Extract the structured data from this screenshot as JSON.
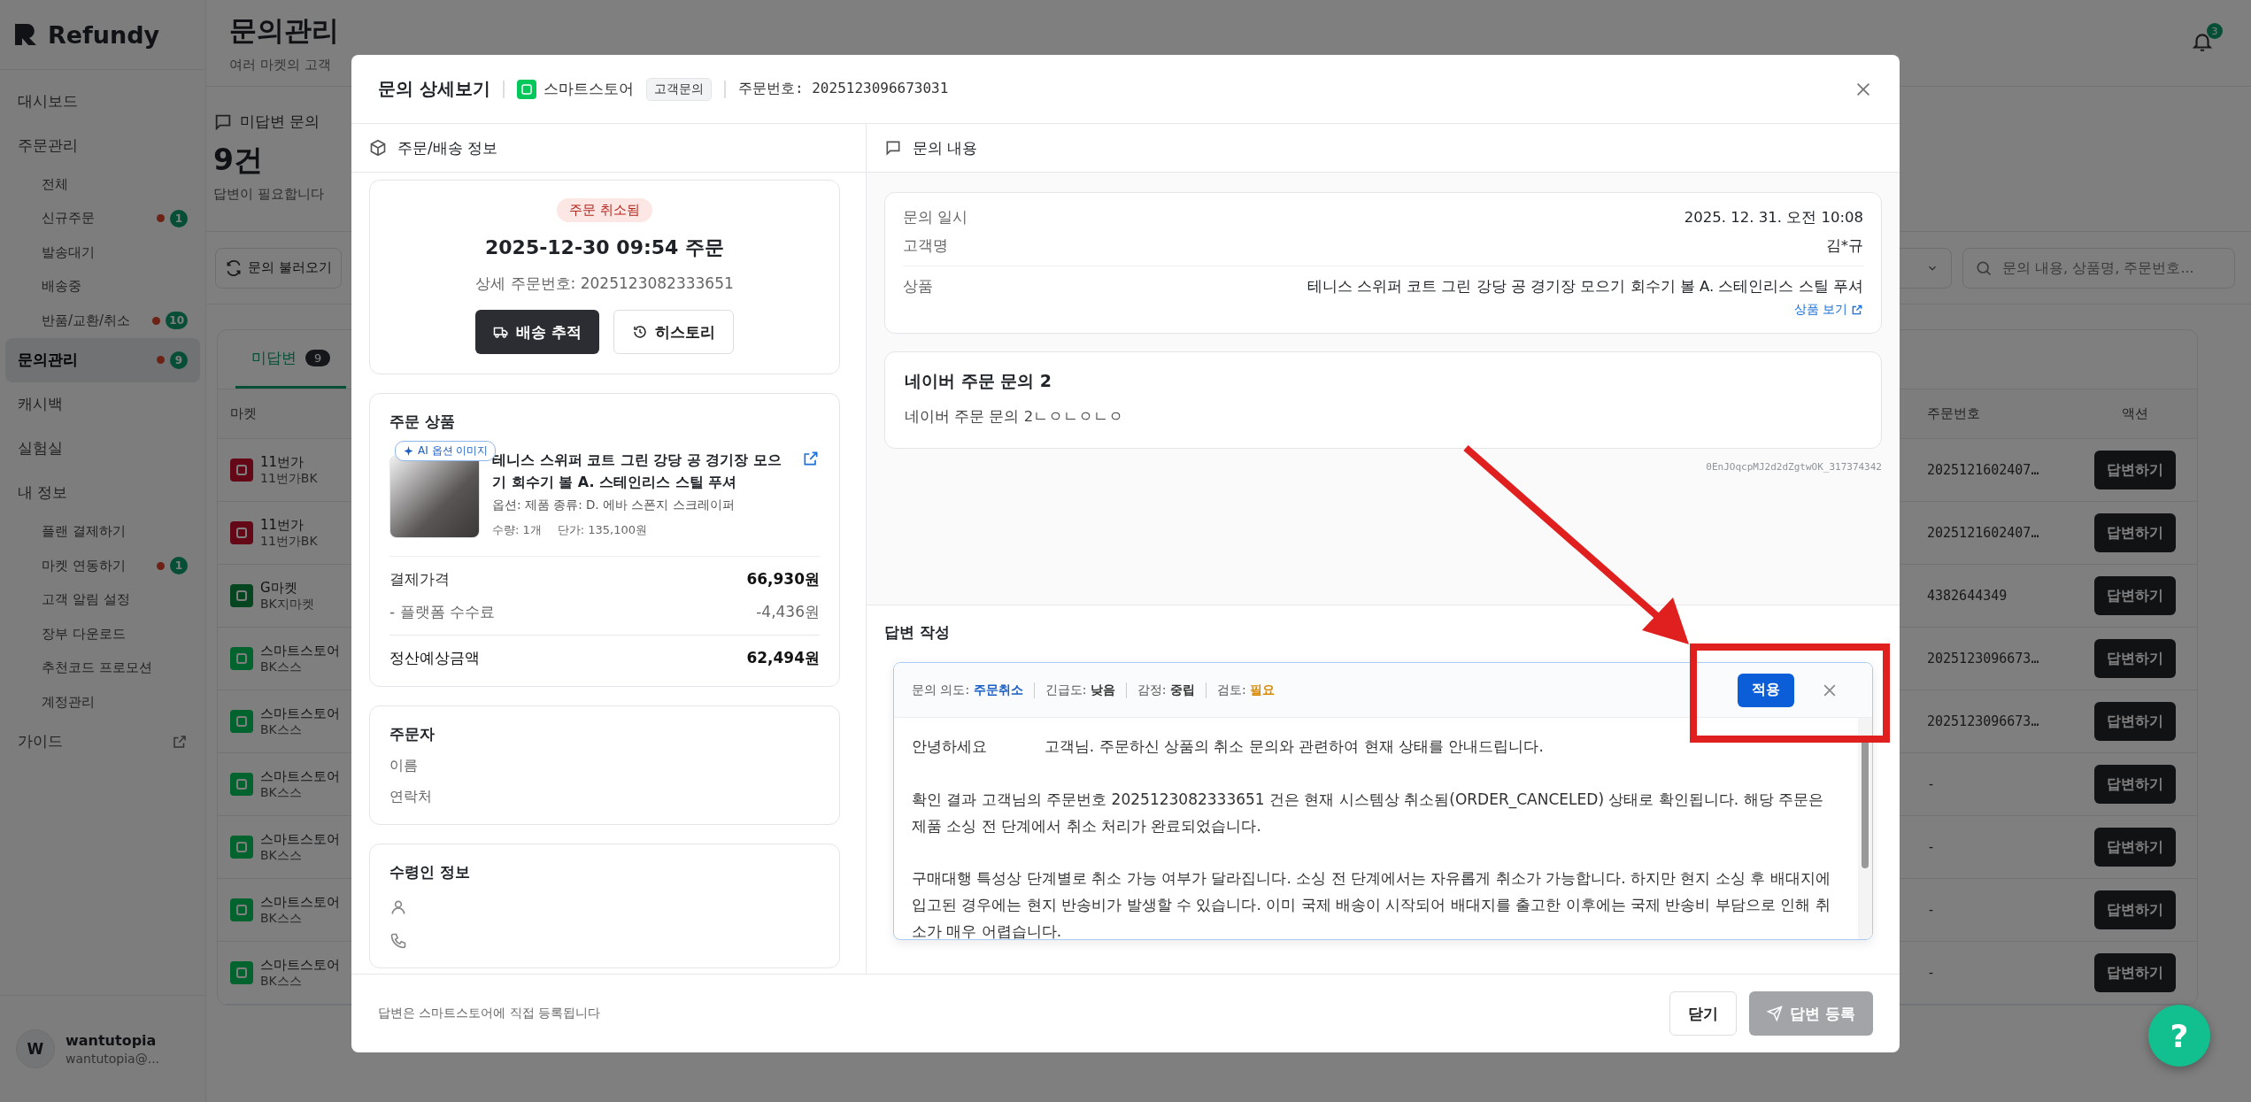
{
  "sidebar": {
    "logo": "Refundy",
    "items": [
      {
        "label": "대시보드",
        "selected": false,
        "kind": "item"
      },
      {
        "label": "주문관리",
        "selected": false,
        "kind": "item",
        "children": [
          {
            "label": "전체",
            "selected": false
          },
          {
            "label": "신규주문",
            "selected": false,
            "badge": "1"
          },
          {
            "label": "발송대기",
            "selected": false
          },
          {
            "label": "배송중",
            "selected": false
          },
          {
            "label": "반품/교환/취소",
            "selected": false,
            "badge": "10"
          }
        ]
      },
      {
        "label": "문의관리",
        "selected": true,
        "kind": "item",
        "badge": "9"
      },
      {
        "label": "캐시백",
        "selected": false,
        "kind": "item"
      },
      {
        "label": "실험실",
        "selected": false,
        "kind": "item"
      },
      {
        "label": "내 정보",
        "selected": false,
        "kind": "item",
        "children": [
          {
            "label": "플랜 결제하기",
            "selected": false
          },
          {
            "label": "마켓 연동하기",
            "selected": false,
            "badge": "1"
          },
          {
            "label": "고객 알림 설정",
            "selected": false
          },
          {
            "label": "장부 다운로드",
            "selected": false
          },
          {
            "label": "추천코드 프로모션",
            "selected": false
          },
          {
            "label": "계정관리",
            "selected": false
          }
        ]
      },
      {
        "label": "가이드",
        "selected": false,
        "kind": "external"
      }
    ],
    "user": {
      "avatar": "W",
      "name": "wantutopia",
      "email": "wantutopia@..."
    }
  },
  "header": {
    "title": "문의관리",
    "subtitle": "여러 마켓의 고객",
    "notification_count": "3"
  },
  "stats": {
    "label": "미답변 문의",
    "value": "9건",
    "note": "답변이 필요합니다"
  },
  "toolbar": {
    "refresh_button": "문의 불러오기",
    "search": {
      "placeholder": "문의 내용, 상품명, 주문번호..."
    }
  },
  "table": {
    "tabs": [
      {
        "label": "미답변",
        "count": "9",
        "selected": true
      }
    ],
    "columns": {
      "market": "마켓",
      "order_number": "주문번호",
      "action": "액션"
    },
    "rows": [
      {
        "market": "11번가",
        "account": "11번가BK",
        "kind": "elevenst",
        "order_number": "2025121602407…",
        "action": "답변하기"
      },
      {
        "market": "11번가",
        "account": "11번가BK",
        "kind": "elevenst",
        "order_number": "2025121602407…",
        "action": "답변하기"
      },
      {
        "market": "G마켓",
        "account": "BK지마켓",
        "kind": "gmarket",
        "order_number": "4382644349",
        "action": "답변하기"
      },
      {
        "market": "스마트스토어",
        "account": "BK스스",
        "kind": "smartstore",
        "order_number": "2025123096673…",
        "action": "답변하기"
      },
      {
        "market": "스마트스토어",
        "account": "BK스스",
        "kind": "smartstore",
        "order_number": "2025123096673…",
        "action": "답변하기"
      },
      {
        "market": "스마트스토어",
        "account": "BK스스",
        "kind": "smartstore",
        "order_number": "-",
        "action": "답변하기"
      },
      {
        "market": "스마트스토어",
        "account": "BK스스",
        "kind": "smartstore",
        "order_number": "-",
        "action": "답변하기"
      },
      {
        "market": "스마트스토어",
        "account": "BK스스",
        "kind": "smartstore",
        "order_number": "-",
        "action": "답변하기"
      },
      {
        "market": "스마트스토어",
        "account": "BK스스",
        "kind": "smartstore",
        "order_number": "-",
        "action": "답변하기"
      }
    ]
  },
  "help_button": {
    "label": "?"
  },
  "modal": {
    "title": "문의 상세보기",
    "market": "스마트스토어",
    "type_badge": "고객문의",
    "order_number": "주문번호: 2025123096673031",
    "left": {
      "heading": "주문/배송 정보",
      "status_badge": "주문 취소됨",
      "ordered_at": "2025-12-30 09:54 주문",
      "detail_order": "상세 주문번호: 2025123082333651",
      "buttons": [
        {
          "label": "배송 추적",
          "kind": "primary"
        },
        {
          "label": "히스토리",
          "kind": "secondary"
        }
      ],
      "product_card": {
        "title": "주문 상품",
        "image_badge": "AI 옵션 이미지",
        "name": "테니스 스위퍼 코트 그린 강당 공 경기장 모으기 회수기 볼 A. 스테인리스 스틸 푸셔",
        "option": "옵션: 제품 종류: D. 에바 스폰지 스크레이퍼",
        "quantity": "수량: 1개",
        "unit_price": "단가: 135,100원",
        "amounts": [
          {
            "label": "결제가격",
            "value": "66,930원",
            "kind": "strong"
          },
          {
            "label": "- 플랫폼 수수료",
            "value": "-4,436원",
            "kind": "muted"
          },
          {
            "label": "정산예상금액",
            "value": "62,494원",
            "kind": "total"
          }
        ]
      },
      "orderer": {
        "title": "주문자",
        "fields": [
          "이름",
          "연락처"
        ]
      },
      "recipient": {
        "title": "수령인 정보"
      }
    },
    "right": {
      "heading": "문의 내용",
      "info": [
        {
          "label": "문의 일시",
          "value": "2025. 12. 31. 오전 10:08"
        },
        {
          "label": "고객명",
          "value": "김*규"
        },
        {
          "label": "상품",
          "value": "테니스 스위퍼 코트 그린 강당 공 경기장 모으기 회수기 볼 A. 스테인리스 스틸 푸셔",
          "link": "상품 보기"
        }
      ],
      "message": {
        "title": "네이버 주문 문의 2",
        "body": "네이버 주문 문의 2ㄴㅇㄴㅇㄴㅇ"
      },
      "message_id": "0EnJOqcpMJ2d2dZgtwOK_317374342",
      "answer": {
        "heading": "답변 작성",
        "tags": [
          {
            "label": "문의 의도:",
            "value": "주문취소",
            "color": "#1a5fc4"
          },
          {
            "label": "긴급도:",
            "value": "낮음",
            "color": "#333333"
          },
          {
            "label": "감정:",
            "value": "중립",
            "color": "#333333"
          },
          {
            "label": "검토:",
            "value": "필요",
            "color": "#d98a00"
          }
        ],
        "apply_button": "적용",
        "paragraphs": [
          "안녕하세요            고객님. 주문하신 상품의 취소 문의와 관련하여 현재 상태를 안내드립니다.",
          "확인 결과 고객님의 주문번호 2025123082333651 건은 현재 시스템상 취소됨(ORDER_CANCELED) 상태로 확인됩니다. 해당 주문은 제품 소싱 전 단계에서 취소 처리가 완료되었습니다.",
          "구매대행 특성상 단계별로 취소 가능 여부가 달라집니다. 소싱 전 단계에서는 자유롭게 취소가 가능합니다. 하지만 현지 소싱 후 배대지에 입고된 경우에는 현지 반송비가 발생할 수 있습니다. 이미 국제 배송이 시작되어 배대지를 출고한 이후에는 국제 반송비 부담으로 인해 취소가 매우 어렵습니다."
        ]
      }
    },
    "footer": {
      "note": "답변은 스마트스토어에 직접 등록됩니다",
      "close_button": "닫기",
      "submit_button": {
        "label": "답변 등록",
        "disabled": true
      }
    }
  }
}
